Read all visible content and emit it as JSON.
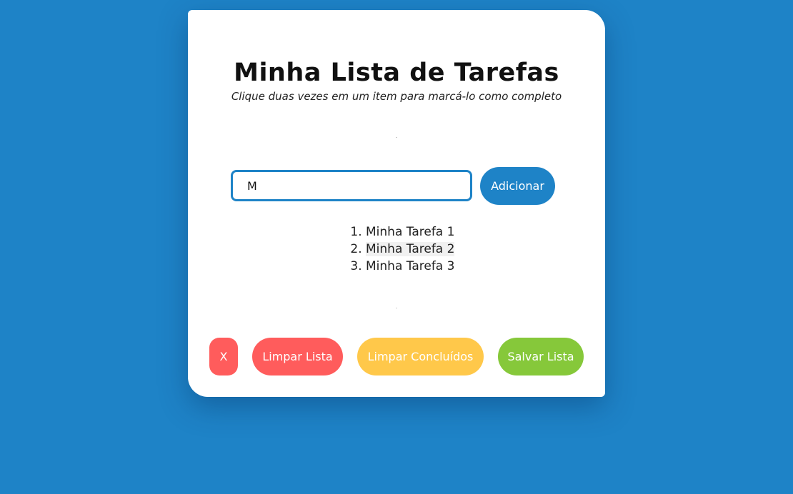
{
  "app": {
    "title": "Minha Lista de Tarefas",
    "subtitle": "Clique duas vezes em um item para marcá-lo como completo"
  },
  "form": {
    "input_value": "M",
    "add_label": "Adicionar"
  },
  "tasks": [
    {
      "label": "Minha Tarefa 1"
    },
    {
      "label": "Minha Tarefa 2"
    },
    {
      "label": "Minha Tarefa 3"
    }
  ],
  "actions": {
    "x_label": "X",
    "clear_list_label": "Limpar Lista",
    "clear_done_label": "Limpar Concluídos",
    "save_list_label": "Salvar Lista"
  },
  "colors": {
    "background": "#1e83c7",
    "primary": "#1e83c7",
    "danger": "#ff5c5c",
    "warning": "#ffc84a",
    "success": "#86c83a"
  }
}
